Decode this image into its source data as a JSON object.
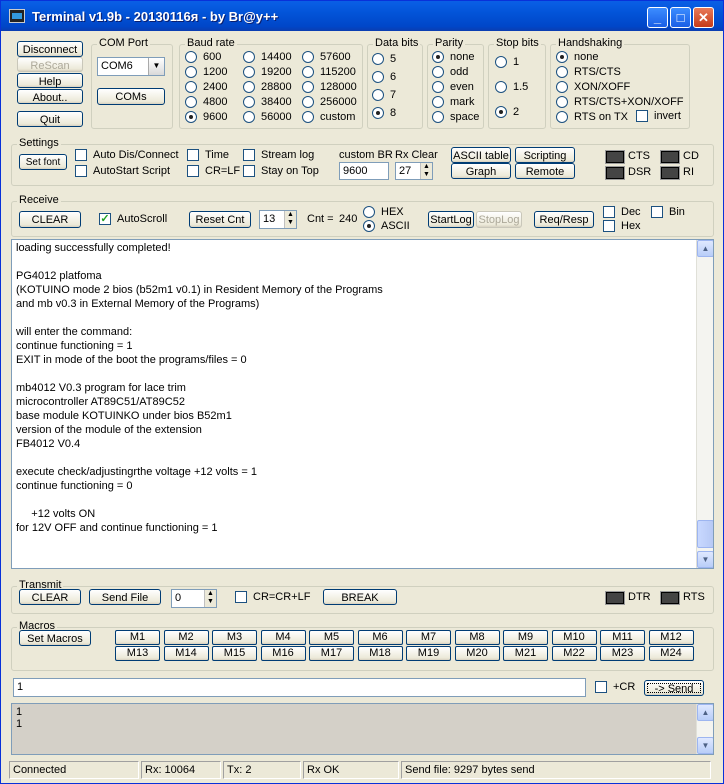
{
  "window": {
    "title": "Terminal v1.9b - 20130116я - by Br@y++"
  },
  "buttons": {
    "disconnect": "Disconnect",
    "rescan": "ReScan",
    "help": "Help",
    "about": "About..",
    "quit": "Quit",
    "coms": "COMs"
  },
  "com_port": {
    "label": "COM Port",
    "value": "COM6"
  },
  "baud": {
    "label": "Baud rate",
    "options": [
      "600",
      "1200",
      "2400",
      "4800",
      "9600",
      "14400",
      "19200",
      "28800",
      "38400",
      "56000",
      "57600",
      "115200",
      "128000",
      "256000",
      "custom"
    ],
    "selected": "9600"
  },
  "data_bits": {
    "label": "Data bits",
    "options": [
      "5",
      "6",
      "7",
      "8"
    ],
    "selected": "8"
  },
  "parity": {
    "label": "Parity",
    "options": [
      "none",
      "odd",
      "even",
      "mark",
      "space"
    ],
    "selected": "none"
  },
  "stop_bits": {
    "label": "Stop bits",
    "options": [
      "1",
      "1.5",
      "2"
    ],
    "selected": "2"
  },
  "handshaking": {
    "label": "Handshaking",
    "options": [
      "none",
      "RTS/CTS",
      "XON/XOFF",
      "RTS/CTS+XON/XOFF",
      "RTS on TX"
    ],
    "selected": "none",
    "invert": "invert"
  },
  "settings": {
    "label": "Settings",
    "set_font": "Set font",
    "auto_dis": "Auto Dis/Connect",
    "autostart": "AutoStart Script",
    "time": "Time",
    "crlf": "CR=LF",
    "stream_log": "Stream log",
    "stay_on_top": "Stay on Top",
    "custom_br_label": "custom BR",
    "custom_br_value": "9600",
    "rx_clear_label": "Rx Clear",
    "rx_clear_value": "27",
    "ascii_table": "ASCII table",
    "graph": "Graph",
    "scripting": "Scripting",
    "remote": "Remote",
    "cts": "CTS",
    "dsr": "DSR",
    "cd": "CD",
    "ri": "RI"
  },
  "receive": {
    "label": "Receive",
    "clear": "CLEAR",
    "autoscroll": "AutoScroll",
    "reset_cnt": "Reset Cnt",
    "cnt_field": "13",
    "cnt_label": "Cnt =",
    "cnt_value": "240",
    "hex": "HEX",
    "ascii": "ASCII",
    "startlog": "StartLog",
    "stoplog": "StopLog",
    "req_resp": "Req/Resp",
    "dec": "Dec",
    "hex_chk": "Hex",
    "bin": "Bin"
  },
  "rx_lines": [
    "loading successfully completed!",
    "",
    "PG4012 platfoma",
    "(KOTUINO mode 2 bios (b52m1 v0.1) in Resident Memory of the Programs",
    "and mb v0.3 in External Memory of the Programs)",
    "",
    "will enter the command:",
    "continue functioning = 1",
    "EXIT in mode of the boot the programs/files = 0",
    "",
    "mb4012 V0.3 program for lace trim",
    "microcontroller AT89C51/AT89C52",
    "base module KOTUINKO under bios B52m1",
    "version of the module of the extension",
    "FB4012 V0.4",
    "",
    "execute check/adjustingrthe voltage +12 volts = 1",
    "continue functioning = 0",
    "",
    "     +12 volts ON",
    "for 12V OFF and continue functioning = 1"
  ],
  "transmit": {
    "label": "Transmit",
    "clear": "CLEAR",
    "send_file": "Send File",
    "field": "0",
    "crcrlf": "CR=CR+LF",
    "break": "BREAK",
    "dtr": "DTR",
    "rts": "RTS"
  },
  "macros": {
    "label": "Macros",
    "set_macros": "Set Macros",
    "items": [
      "M1",
      "M2",
      "M3",
      "M4",
      "M5",
      "M6",
      "M7",
      "M8",
      "M9",
      "M10",
      "M11",
      "M12",
      "M13",
      "M14",
      "M15",
      "M16",
      "M17",
      "M18",
      "M19",
      "M20",
      "M21",
      "M22",
      "M23",
      "M24"
    ]
  },
  "send": {
    "input": "1",
    "cr_label": "+CR",
    "send": "-> Send"
  },
  "tx_history": [
    "1",
    "1"
  ],
  "status": {
    "connected": "Connected",
    "rx": "Rx: 10064",
    "tx": "Tx: 2",
    "rx_ok": "Rx OK",
    "send_file": "Send file: 9297 bytes send"
  }
}
